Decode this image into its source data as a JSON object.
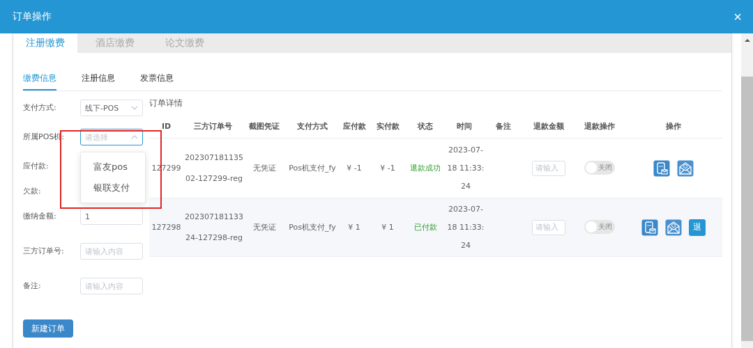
{
  "window": {
    "title": "订单操作",
    "close": "×"
  },
  "tabs": [
    {
      "label": "注册缴费",
      "selected": true
    },
    {
      "label": "酒店缴费",
      "selected": false
    },
    {
      "label": "论文缴费",
      "selected": false
    }
  ],
  "subtabs": [
    {
      "label": "缴费信息",
      "selected": true
    },
    {
      "label": "注册信息",
      "selected": false
    },
    {
      "label": "发票信息",
      "selected": false
    }
  ],
  "form": {
    "fields": [
      {
        "kind": "select",
        "label": "支付方式:",
        "value": "线下-POS",
        "open": false
      },
      {
        "kind": "select",
        "label": "所属POS机:",
        "placeholder": "请选择",
        "open": true,
        "options": [
          "富友pos",
          "银联支付"
        ]
      },
      {
        "kind": "text",
        "label": "应付款:"
      },
      {
        "kind": "text",
        "label": "欠款:"
      },
      {
        "kind": "input",
        "label": "缴纳金额:",
        "value": "1"
      },
      {
        "kind": "input",
        "label": "三方订单号:",
        "placeholder": "请输入内容"
      },
      {
        "kind": "input",
        "label": "备注:",
        "placeholder": "请输入内容"
      }
    ],
    "submit": "新建订单"
  },
  "table": {
    "caption": "订单详情",
    "columns": [
      "ID",
      "三方订单号",
      "截图凭证",
      "支付方式",
      "应付款",
      "实付款",
      "状态",
      "时间",
      "备注",
      "退款金额",
      "退款操作",
      "操作"
    ],
    "rows": [
      {
        "id": "127299",
        "order_no": "20230718113502-127299-reg",
        "voucher": "无凭证",
        "method": "Pos机支付_fy",
        "due": "¥ -1",
        "paid": "¥ -1",
        "status": "退款成功",
        "time": "2023-07-18 11:33:24",
        "refund_placeholder": "请输入",
        "refund_switch": {
          "on": false,
          "label": "关闭"
        },
        "actions": [
          {
            "kind": "sms"
          },
          {
            "kind": "mail"
          }
        ]
      },
      {
        "id": "127298",
        "order_no": "20230718113324-127298-reg",
        "voucher": "无凭证",
        "method": "Pos机支付_fy",
        "due": "¥ 1",
        "paid": "¥ 1",
        "status": "已付款",
        "time": "2023-07-18 11:33:24",
        "refund_placeholder": "请输入",
        "refund_switch": {
          "on": false,
          "label": "关闭"
        },
        "actions": [
          {
            "kind": "sms"
          },
          {
            "kind": "mail"
          },
          {
            "kind": "refund",
            "label": "退"
          }
        ]
      }
    ]
  }
}
